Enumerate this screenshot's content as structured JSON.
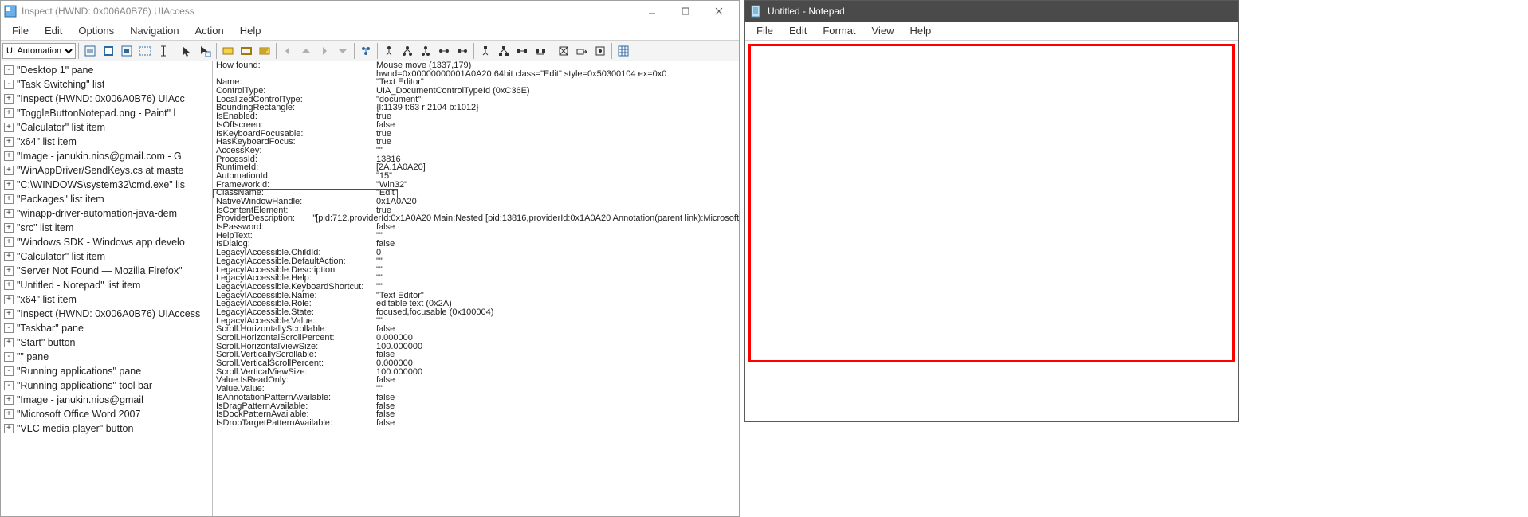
{
  "inspect": {
    "title": "Inspect  (HWND: 0x006A0B76)  UIAccess",
    "menus": [
      "File",
      "Edit",
      "Options",
      "Navigation",
      "Action",
      "Help"
    ],
    "toolbar_mode": "UI Automation",
    "tree": [
      {
        "indent": 0,
        "exp": "-",
        "label": "\"Desktop 1\" pane"
      },
      {
        "indent": 1,
        "exp": "-",
        "label": "\"Task Switching\" list"
      },
      {
        "indent": 2,
        "exp": "+",
        "label": "\"Inspect  (HWND: 0x006A0B76)  UIAcc"
      },
      {
        "indent": 2,
        "exp": "+",
        "label": "\"ToggleButtonNotepad.png - Paint\" l"
      },
      {
        "indent": 2,
        "exp": "+",
        "label": "\"Calculator\" list item"
      },
      {
        "indent": 2,
        "exp": "+",
        "label": "\"x64\" list item"
      },
      {
        "indent": 2,
        "exp": "+",
        "label": "\"Image - janukin.nios@gmail.com - G"
      },
      {
        "indent": 2,
        "exp": "+",
        "label": "\"WinAppDriver/SendKeys.cs at maste"
      },
      {
        "indent": 2,
        "exp": "+",
        "label": "\"C:\\WINDOWS\\system32\\cmd.exe\" lis"
      },
      {
        "indent": 2,
        "exp": "+",
        "label": "\"Packages\" list item"
      },
      {
        "indent": 2,
        "exp": "+",
        "label": "\"winapp-driver-automation-java-dem"
      },
      {
        "indent": 2,
        "exp": "+",
        "label": "\"src\" list item"
      },
      {
        "indent": 2,
        "exp": "+",
        "label": "\"Windows SDK - Windows app develo"
      },
      {
        "indent": 2,
        "exp": "+",
        "label": "\"Calculator\" list item"
      },
      {
        "indent": 2,
        "exp": "+",
        "label": "\"Server Not Found — Mozilla Firefox\""
      },
      {
        "indent": 2,
        "exp": "+",
        "label": "\"Untitled - Notepad\" list item"
      },
      {
        "indent": 2,
        "exp": "+",
        "label": "\"x64\" list item"
      },
      {
        "indent": 1,
        "exp": "+",
        "label": "\"Inspect  (HWND: 0x006A0B76)  UIAccess"
      },
      {
        "indent": 1,
        "exp": "-",
        "label": "\"Taskbar\" pane"
      },
      {
        "indent": 2,
        "exp": "+",
        "label": "\"Start\" button"
      },
      {
        "indent": 2,
        "exp": "-",
        "label": "\"\" pane"
      },
      {
        "indent": 3,
        "exp": "-",
        "label": "\"Running applications\" pane"
      },
      {
        "indent": 4,
        "exp": "-",
        "label": "\"Running applications\" tool bar"
      },
      {
        "indent": 5,
        "exp": "+",
        "label": "\"Image - janukin.nios@gmail"
      },
      {
        "indent": 5,
        "exp": "+",
        "label": "\"Microsoft Office Word 2007"
      },
      {
        "indent": 5,
        "exp": "+",
        "label": "\"VLC media player\" button"
      }
    ],
    "props": [
      {
        "k": "How found:",
        "v": "Mouse move (1337,179)"
      },
      {
        "k": "",
        "v": "hwnd=0x00000000001A0A20 64bit class=\"Edit\" style=0x50300104 ex=0x0"
      },
      {
        "k": "Name:",
        "v": "\"Text Editor\""
      },
      {
        "k": "ControlType:",
        "v": "UIA_DocumentControlTypeId (0xC36E)"
      },
      {
        "k": "LocalizedControlType:",
        "v": "\"document\""
      },
      {
        "k": "BoundingRectangle:",
        "v": "{l:1139 t:63 r:2104 b:1012}"
      },
      {
        "k": "IsEnabled:",
        "v": "true"
      },
      {
        "k": "IsOffscreen:",
        "v": "false"
      },
      {
        "k": "IsKeyboardFocusable:",
        "v": "true"
      },
      {
        "k": "HasKeyboardFocus:",
        "v": "true"
      },
      {
        "k": "AccessKey:",
        "v": "\"\""
      },
      {
        "k": "ProcessId:",
        "v": "13816"
      },
      {
        "k": "RuntimeId:",
        "v": "[2A.1A0A20]"
      },
      {
        "k": "AutomationId:",
        "v": "\"15\""
      },
      {
        "k": "FrameworkId:",
        "v": "\"Win32\""
      },
      {
        "k": "ClassName:",
        "v": "\"Edit\""
      },
      {
        "k": "NativeWindowHandle:",
        "v": "0x1A0A20"
      },
      {
        "k": "IsContentElement:",
        "v": "true"
      },
      {
        "k": "ProviderDescription:",
        "v": "\"[pid:712,providerId:0x1A0A20 Main:Nested [pid:13816,providerId:0x1A0A20 Annotation(parent link):Microsoft"
      },
      {
        "k": "IsPassword:",
        "v": "false"
      },
      {
        "k": "HelpText:",
        "v": "\"\""
      },
      {
        "k": "IsDialog:",
        "v": "false"
      },
      {
        "k": "LegacyIAccessible.ChildId:",
        "v": "0"
      },
      {
        "k": "LegacyIAccessible.DefaultAction:",
        "v": "\"\""
      },
      {
        "k": "LegacyIAccessible.Description:",
        "v": "\"\""
      },
      {
        "k": "LegacyIAccessible.Help:",
        "v": "\"\""
      },
      {
        "k": "LegacyIAccessible.KeyboardShortcut:",
        "v": "\"\""
      },
      {
        "k": "LegacyIAccessible.Name:",
        "v": "\"Text Editor\""
      },
      {
        "k": "LegacyIAccessible.Role:",
        "v": "editable text (0x2A)"
      },
      {
        "k": "LegacyIAccessible.State:",
        "v": "focused,focusable (0x100004)"
      },
      {
        "k": "LegacyIAccessible.Value:",
        "v": "\"\""
      },
      {
        "k": "Scroll.HorizontallyScrollable:",
        "v": "false"
      },
      {
        "k": "Scroll.HorizontalScrollPercent:",
        "v": "0.000000"
      },
      {
        "k": "Scroll.HorizontalViewSize:",
        "v": "100.000000"
      },
      {
        "k": "Scroll.VerticallyScrollable:",
        "v": "false"
      },
      {
        "k": "Scroll.VerticalScrollPercent:",
        "v": "0.000000"
      },
      {
        "k": "Scroll.VerticalViewSize:",
        "v": "100.000000"
      },
      {
        "k": "Value.IsReadOnly:",
        "v": "false"
      },
      {
        "k": "Value.Value:",
        "v": "\"\""
      },
      {
        "k": "IsAnnotationPatternAvailable:",
        "v": "false"
      },
      {
        "k": "IsDragPatternAvailable:",
        "v": "false"
      },
      {
        "k": "IsDockPatternAvailable:",
        "v": "false"
      },
      {
        "k": "IsDropTargetPatternAvailable:",
        "v": "false"
      }
    ],
    "highlight_row": 15
  },
  "notepad": {
    "title": "Untitled - Notepad",
    "menus": [
      "File",
      "Edit",
      "Format",
      "View",
      "Help"
    ],
    "content": ""
  }
}
